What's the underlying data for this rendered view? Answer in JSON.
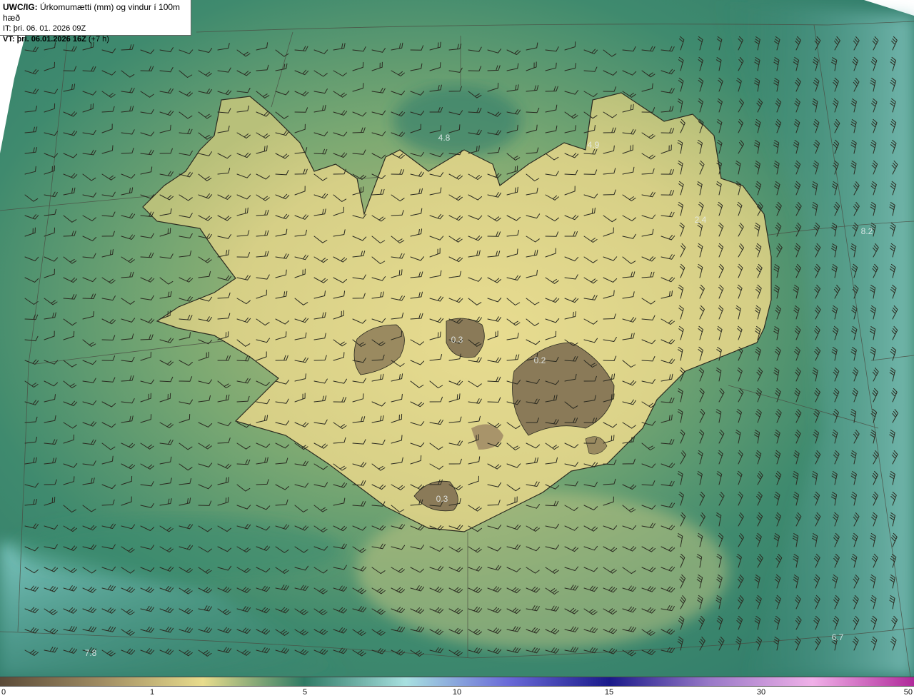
{
  "header": {
    "product": "UWC/IG:",
    "title": "Úrkomumætti (mm) og vindur í 100m hæð",
    "it_label": "IT:",
    "it_value": "þri. 06. 01. 2026 09Z",
    "vt_label": "VT:",
    "vt_value": "þri. 06.01.2026 16Z",
    "vt_offset": "(+7 h)"
  },
  "value_labels": [
    "4.8",
    "4.9",
    "2.4",
    "8.2",
    "0.3",
    "0.2",
    "0.3",
    "6.7",
    "7.8"
  ],
  "colorbar": {
    "ticks": [
      "0",
      "1",
      "5",
      "10",
      "15",
      "30",
      "50"
    ],
    "colors": [
      "#5a4a38",
      "#a08c62",
      "#e8dc8c",
      "#2e7a64",
      "#a8e0e0",
      "#6a6ad8",
      "#1a1a8a",
      "#9a7ac8",
      "#f0b0e8",
      "#b02a9a"
    ]
  },
  "map_colors": {
    "land_core": "#8a7a58",
    "land": "#e6dc8c",
    "sea_near": "#4a8a70",
    "sea_far": "#2e7a6a",
    "sea_light": "#8fcfc8",
    "coast": "#2a2a20"
  }
}
